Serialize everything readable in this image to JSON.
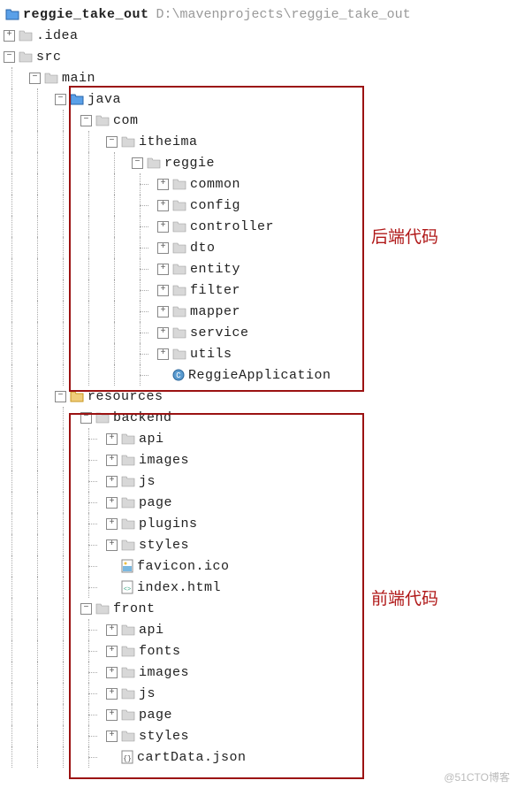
{
  "root": {
    "name": "reggie_take_out",
    "path": "D:\\mavenprojects\\reggie_take_out"
  },
  "nodes": {
    "idea": ".idea",
    "src": "src",
    "main": "main",
    "java": "java",
    "com": "com",
    "itheima": "itheima",
    "reggie": "reggie",
    "common": "common",
    "config": "config",
    "controller": "controller",
    "dto": "dto",
    "entity": "entity",
    "filter": "filter",
    "mapper": "mapper",
    "service": "service",
    "utils": "utils",
    "reggieApp": "ReggieApplication",
    "resources": "resources",
    "backend": "backend",
    "api": "api",
    "images": "images",
    "js": "js",
    "page": "page",
    "plugins": "plugins",
    "styles": "styles",
    "favicon": "favicon.ico",
    "indexhtml": "index.html",
    "front": "front",
    "api2": "api",
    "fonts": "fonts",
    "images2": "images",
    "js2": "js",
    "page2": "page",
    "styles2": "styles",
    "cartdata": "cartData.json"
  },
  "annotations": {
    "backend": "后端代码",
    "frontend": "前端代码"
  },
  "watermark": "@51CTO博客"
}
